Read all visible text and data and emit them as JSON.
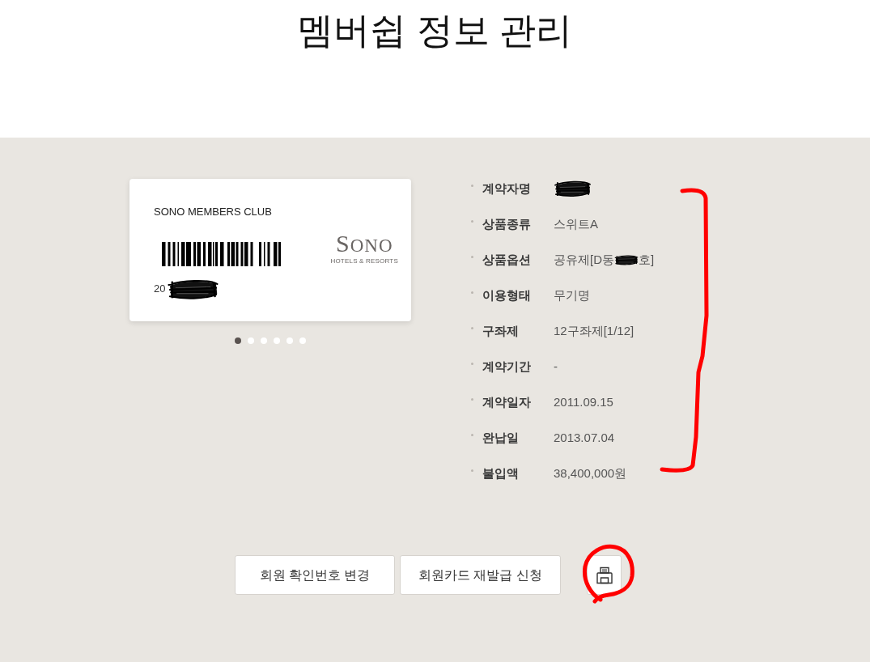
{
  "title": "멤버쉽 정보 관리",
  "member_card": {
    "club_name": "SONO MEMBERS CLUB",
    "card_number": "20",
    "card_number_redacted": true,
    "logo": {
      "wordmark": "SONO",
      "tagline": "HOTELS & RESORTS"
    }
  },
  "card_pagination": [
    {
      "selected": true
    },
    {
      "selected": false
    },
    {
      "selected": false
    },
    {
      "selected": false
    },
    {
      "selected": false
    },
    {
      "selected": false
    }
  ],
  "contract_details": [
    {
      "label": "계약자명",
      "redacted": true
    },
    {
      "label": "상품종류",
      "value": "스위트A",
      "redacted": false
    },
    {
      "label": "상품옵션",
      "value": "공유제[D동",
      "redacted": true,
      "value_after": "호]"
    },
    {
      "label": "이용형태",
      "value": "무기명",
      "redacted": false
    },
    {
      "label": "구좌제",
      "value": "12구좌제[1/12]",
      "redacted": false
    },
    {
      "label": "계약기간",
      "value": "-",
      "redacted": false
    },
    {
      "label": "계약일자",
      "value": "2011.09.15",
      "redacted": false
    },
    {
      "label": "완납일",
      "value": "2013.07.04",
      "redacted": false
    },
    {
      "label": "불입액",
      "value": "38,400,000원",
      "redacted": false
    }
  ],
  "buttons": [
    {
      "kind": "text",
      "label": "회원 확인번호 변경"
    },
    {
      "kind": "text",
      "label": "회원카드 재발급 신청"
    },
    {
      "kind": "print"
    }
  ]
}
